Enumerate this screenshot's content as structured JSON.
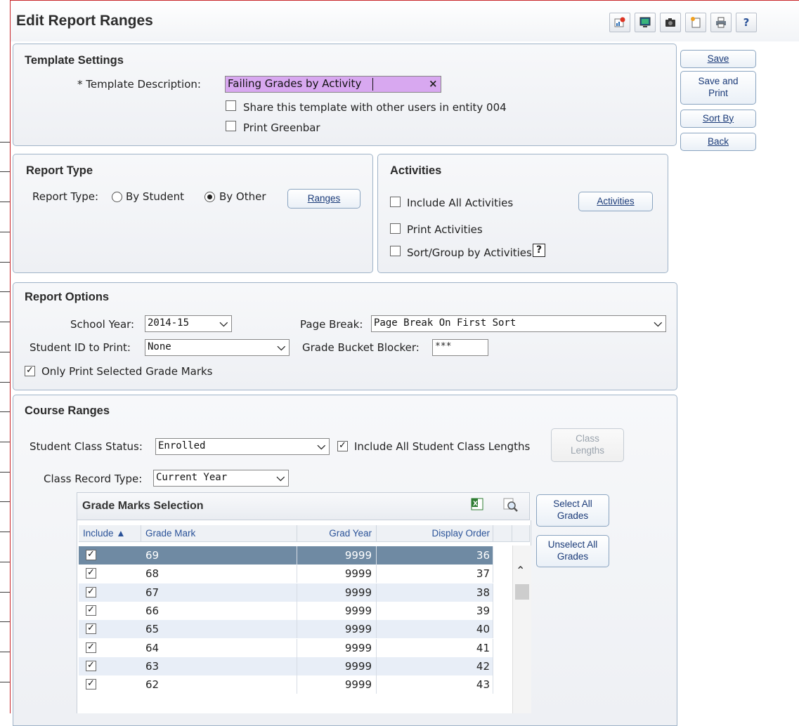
{
  "window": {
    "title": "Edit Report Ranges"
  },
  "toolbar": {
    "icons": [
      "report-icon",
      "monitor-icon",
      "camera-icon",
      "page-icon",
      "printer-icon",
      "help-icon"
    ],
    "help_label": "?"
  },
  "side_buttons": {
    "save": "Save",
    "save_print": "Save and\nPrint",
    "sort_by": "Sort By",
    "back": "Back"
  },
  "template_settings": {
    "title": "Template Settings",
    "description_label": "* Template Description:",
    "description_value": "Failing Grades by Activity",
    "clear_glyph": "×",
    "share_label": "Share this template with other users in entity 004",
    "share_checked": false,
    "greenbar_label": "Print Greenbar",
    "greenbar_checked": false
  },
  "report_type": {
    "title": "Report Type",
    "label": "Report Type:",
    "option_student": "By Student",
    "option_other": "By Other",
    "selected": "By Other",
    "ranges_button": "Ranges"
  },
  "activities": {
    "title": "Activities",
    "include_all_label": "Include All Activities",
    "include_all_checked": false,
    "activities_button": "Activities",
    "print_label": "Print Activities",
    "print_checked": false,
    "sort_group_label": "Sort/Group by Activities",
    "sort_group_checked": false,
    "help_glyph": "?"
  },
  "report_options": {
    "title": "Report Options",
    "school_year_label": "School Year:",
    "school_year_value": "2014-15",
    "page_break_label": "Page Break:",
    "page_break_value": "Page Break On First Sort",
    "student_id_label": "Student ID to Print:",
    "student_id_value": "None",
    "grade_bucket_label": "Grade Bucket Blocker:",
    "grade_bucket_value": "***",
    "only_print_label": "Only Print Selected Grade Marks",
    "only_print_checked": true
  },
  "course_ranges": {
    "title": "Course Ranges",
    "class_status_label": "Student Class Status:",
    "class_status_value": "Enrolled",
    "include_lengths_label": "Include All Student Class Lengths",
    "include_lengths_checked": true,
    "class_lengths_button": "Class\nLengths",
    "record_type_label": "Class Record Type:",
    "record_type_value": "Current Year"
  },
  "grade_marks": {
    "title": "Grade Marks Selection",
    "select_all_button": "Select All\nGrades",
    "unselect_all_button": "Unselect All\nGrades",
    "columns": {
      "include": "Include ▲",
      "grade_mark": "Grade Mark",
      "grad_year": "Grad Year",
      "display_order": "Display Order"
    },
    "rows": [
      {
        "checked": true,
        "grade_mark": "69",
        "grad_year": "9999",
        "display_order": "36",
        "selected": true
      },
      {
        "checked": true,
        "grade_mark": "68",
        "grad_year": "9999",
        "display_order": "37"
      },
      {
        "checked": true,
        "grade_mark": "67",
        "grad_year": "9999",
        "display_order": "38"
      },
      {
        "checked": true,
        "grade_mark": "66",
        "grad_year": "9999",
        "display_order": "39"
      },
      {
        "checked": true,
        "grade_mark": "65",
        "grad_year": "9999",
        "display_order": "40"
      },
      {
        "checked": true,
        "grade_mark": "64",
        "grad_year": "9999",
        "display_order": "41"
      },
      {
        "checked": true,
        "grade_mark": "63",
        "grad_year": "9999",
        "display_order": "42"
      },
      {
        "checked": true,
        "grade_mark": "62",
        "grad_year": "9999",
        "display_order": "43"
      }
    ]
  },
  "colors": {
    "selected_row": "#6f8aa3",
    "alt_row": "#e8eef7",
    "accent_border": "#c8262a",
    "highlight_input": "#d8a8f0"
  }
}
